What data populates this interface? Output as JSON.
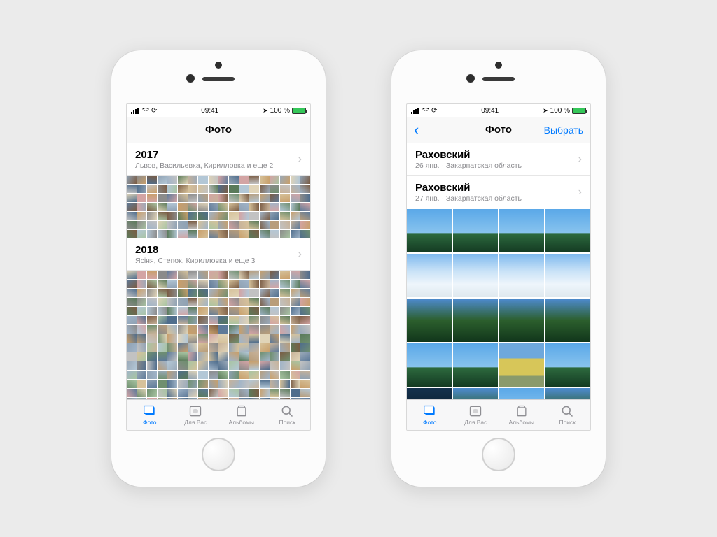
{
  "status": {
    "time": "09:41",
    "battery_text": "100 %"
  },
  "nav": {
    "title": "Фото",
    "select": "Выбрать"
  },
  "tabs": {
    "photos": "Фото",
    "for_you": "Для Вас",
    "albums": "Альбомы",
    "search": "Поиск"
  },
  "left_screen": {
    "sections": [
      {
        "title": "2017",
        "sub": "Львов, Васильевка, Кирилловка и еще 2"
      },
      {
        "title": "2018",
        "sub": "Ясіня, Степок, Кирилловка и еще 3"
      }
    ]
  },
  "right_screen": {
    "sections": [
      {
        "title": "Раховский",
        "sub": "26 янв.  ·  Закарпатская область"
      },
      {
        "title": "Раховский",
        "sub": "27 янв.  ·  Закарпатская область"
      }
    ]
  }
}
